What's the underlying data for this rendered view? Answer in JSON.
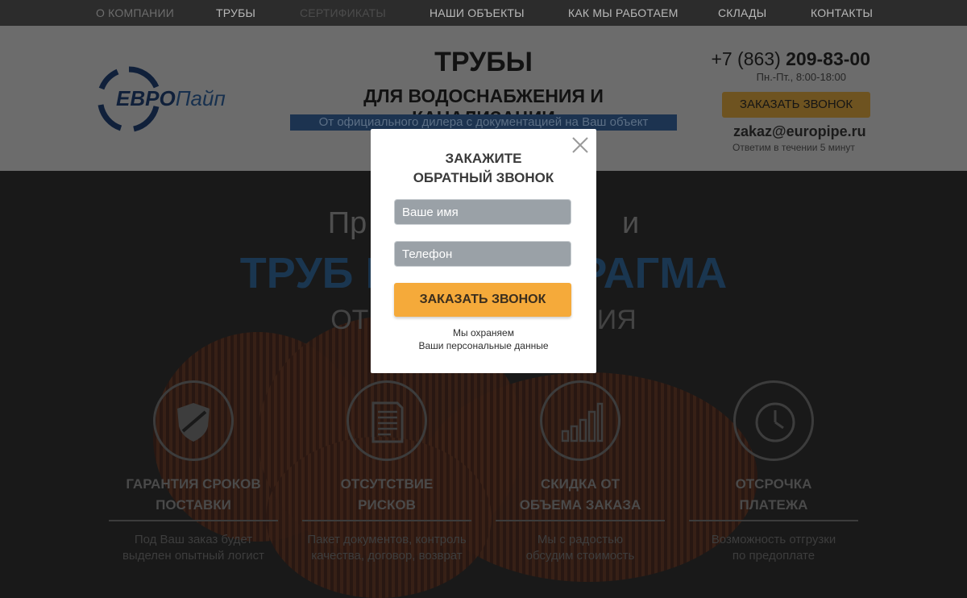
{
  "nav": {
    "items": [
      {
        "label": "О КОМПАНИИ"
      },
      {
        "label": "ТРУБЫ"
      },
      {
        "label": "СЕРТИФИКАТЫ"
      },
      {
        "label": "НАШИ ОБЪЕКТЫ"
      },
      {
        "label": "КАК МЫ РАБОТАЕМ"
      },
      {
        "label": "СКЛАДЫ"
      },
      {
        "label": "КОНТАКТЫ"
      }
    ]
  },
  "header": {
    "logo_part1": "ЕВРО",
    "logo_part2": "Пайп",
    "title": "ТРУБЫ",
    "subtitle": "ДЛЯ ВОДОСНАБЖЕНИЯ И КАНАЛИЗАЦИИ",
    "tagline": "От официального дилера с документацией на Ваш объект",
    "phone_prefix": "+7 (863) ",
    "phone_number": "209-83-00",
    "hours": "Пн.-Пт., 8:00-18:00",
    "call_button": "ЗАКАЗАТЬ ЗВОНОК",
    "email": "zakaz@europipe.ru",
    "reply_note": "Ответим в течении 5 минут"
  },
  "hero": {
    "line1": "Пр                              и",
    "line2": "ТРУБ П               РАГМА",
    "line3": "ОТ                              ИЯ"
  },
  "features": [
    {
      "title_1": "ГАРАНТИЯ СРОКОВ",
      "title_2": "ПОСТАВКИ",
      "desc_1": "Под Ваш заказ будет",
      "desc_2": "выделен опытный логист",
      "icon": "shield-icon"
    },
    {
      "title_1": "ОТСУТСТВИЕ",
      "title_2": "РИСКОВ",
      "desc_1": "Пакет документов, контроль",
      "desc_2": "качества, договор, возврат",
      "icon": "document-icon"
    },
    {
      "title_1": "СКИДКА ОТ",
      "title_2": "ОБЪЕМА ЗАКАЗА",
      "desc_1": "Мы с радостью",
      "desc_2": "обсудим стоимость",
      "icon": "bar-chart-icon"
    },
    {
      "title_1": "ОТСРОЧКА",
      "title_2": "ПЛАТЕЖА",
      "desc_1": "Возможность отгрузки",
      "desc_2": "по предоплате",
      "icon": "clock-icon"
    }
  ],
  "modal": {
    "title_1": "ЗАКАЖИТЕ",
    "title_2": "ОБРАТНЫЙ ЗВОНОК",
    "name_placeholder": "Ваше имя",
    "phone_placeholder": "Телефон",
    "submit": "ЗАКАЗАТЬ ЗВОНОК",
    "note_1": "Мы охраняем",
    "note_2": "Ваши персональные данные"
  },
  "colors": {
    "accent": "#f5aa3a",
    "input_bg": "#9aa1a7",
    "brand_blue": "#1a3650"
  }
}
